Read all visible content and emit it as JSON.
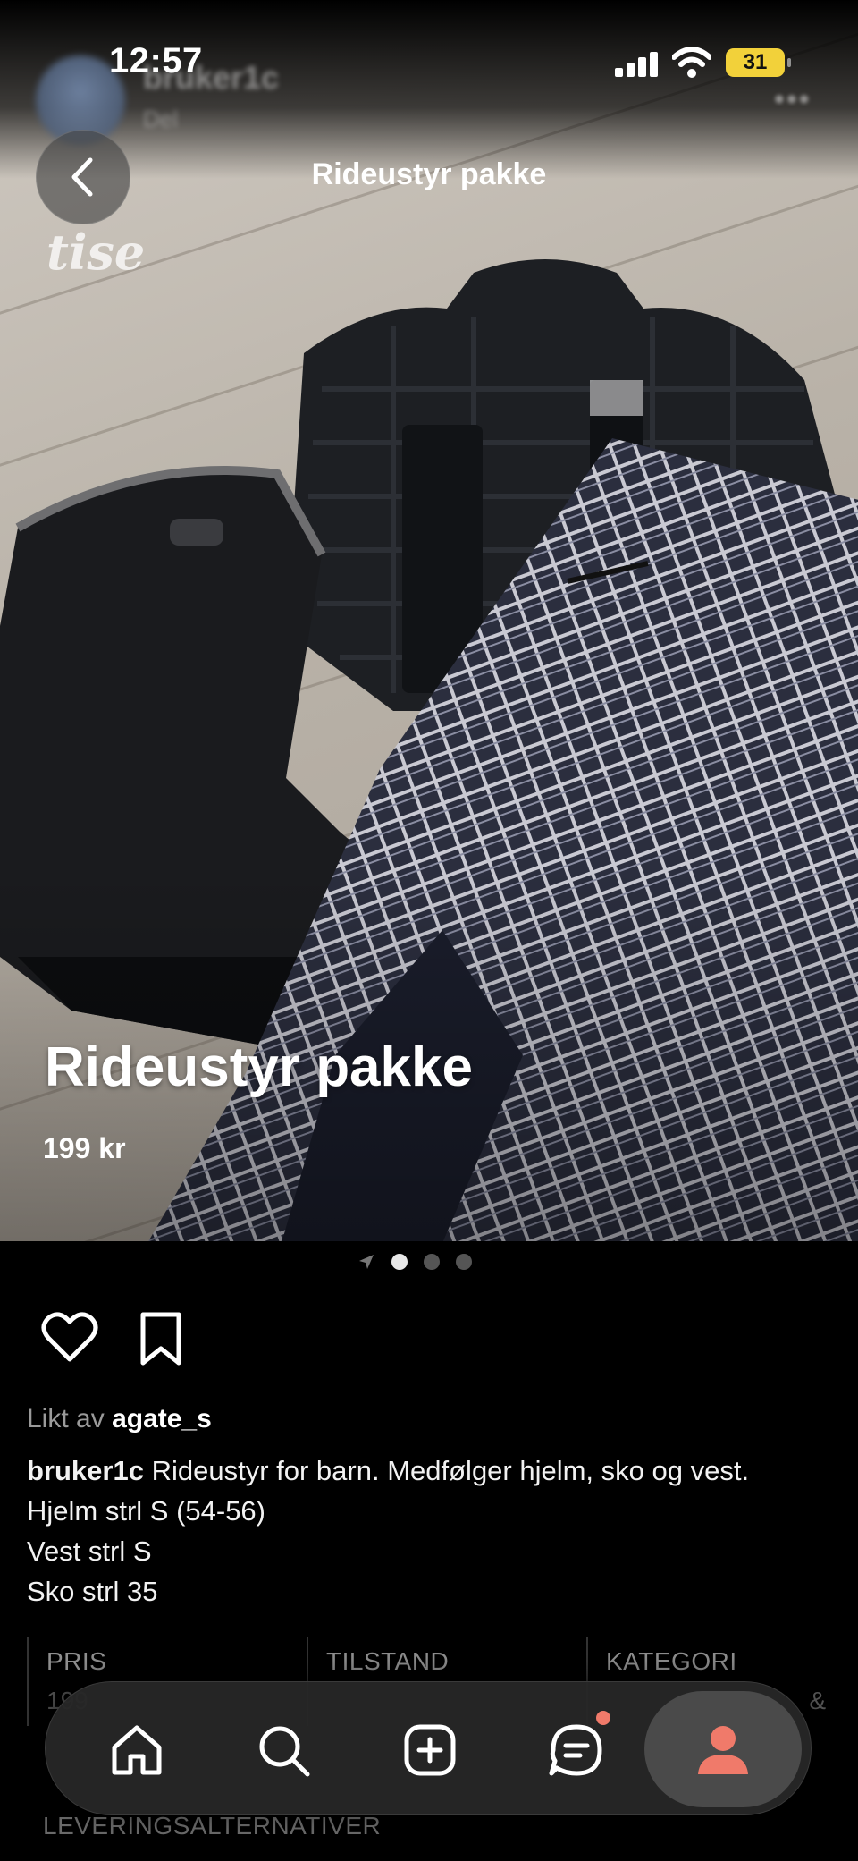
{
  "status_bar": {
    "time": "12:57",
    "battery": "31"
  },
  "header": {
    "username": "bruker1c",
    "subtitle": "Del",
    "more": "•••",
    "title": "Rideustyr pakke",
    "brand": "tise"
  },
  "hero": {
    "title": "Rideustyr pakke",
    "price": "199 kr"
  },
  "carousel": {
    "count": 3,
    "active_index": 0
  },
  "likes": {
    "prefix": "Likt av",
    "user": "agate_s"
  },
  "post": {
    "author": "bruker1c",
    "lines": [
      "Rideustyr for barn. Medfølger hjelm, sko og vest.",
      "Hjelm strl S (54-56)",
      "Vest strl S",
      "Sko strl 35"
    ]
  },
  "details": {
    "columns": [
      {
        "label": "PRIS",
        "value": "199"
      },
      {
        "label": "TILSTAND",
        "value": ""
      },
      {
        "label": "KATEGORI",
        "value": "&"
      }
    ]
  },
  "delivery_label": "LEVERINGSALTERNATIVER",
  "tabbar": {
    "items": [
      "home-icon",
      "search-icon",
      "add-icon",
      "chat-icon",
      "profile-icon"
    ],
    "active": "profile-icon",
    "chat_badge": true
  },
  "colors": {
    "background": "#000000",
    "tabbar": "#262626",
    "accent": "#f07a6a",
    "battery": "#f2d13a"
  }
}
